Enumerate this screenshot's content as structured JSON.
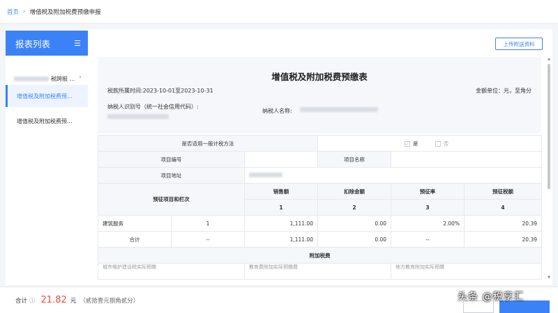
{
  "breadcrumb": {
    "home": "首页",
    "separator": "›",
    "current": "增值税及附加税费预缴申报"
  },
  "sidebar": {
    "title": "报表列表",
    "menu_icon": "list-icon",
    "group_label": "税跨报 ...",
    "items": [
      {
        "label": "增值税及附加税费预...",
        "active": true
      },
      {
        "label": "增值税及附加税费预..."
      }
    ]
  },
  "upload_button": "上传附送资料",
  "form": {
    "title": "增值税及附加税费预缴表",
    "period": "税款所属时间:2023-10-01至2023-10-31",
    "unit": "金额单位：元，至角分",
    "taxpayer_id_label": "纳税人识别号（统一社会信用代码）:",
    "taxpayer_name_label": "纳税人名称:"
  },
  "table": {
    "general_method_label": "是否适用一般计税方法",
    "yes": "是",
    "no": "否",
    "project_no_label": "项目编号",
    "project_name_label": "项目名称",
    "project_addr_label": "项目地址",
    "prepay_label": "预征项目和栏次",
    "headers": [
      "销售额",
      "扣除金额",
      "预征率",
      "预征税额"
    ],
    "col_nums": [
      "1",
      "2",
      "3",
      "4"
    ],
    "rows": [
      {
        "name": "建筑服务",
        "seq": "1",
        "sales": "1,111.00",
        "deduct": "0.00",
        "rate": "2.00%",
        "tax": "20.39"
      },
      {
        "name": "合计",
        "seq": "--",
        "sales": "1,111.00",
        "deduct": "0.00",
        "rate": "--",
        "tax": "20.39"
      }
    ],
    "surtax_label": "附加税费",
    "clipped": [
      "城市维护建设税实际预缴",
      "教育费附加实际预缴费",
      "地方教育附加实际预缴"
    ]
  },
  "footer": {
    "total_label": "合计",
    "info_icon": "info-icon",
    "amount": "21.82",
    "unit": "元",
    "words": "（贰拾壹元捌角贰分）"
  },
  "watermark": "头条 @税享汇",
  "colors": {
    "accent": "#3b82f6",
    "total": "#f04a3a"
  }
}
